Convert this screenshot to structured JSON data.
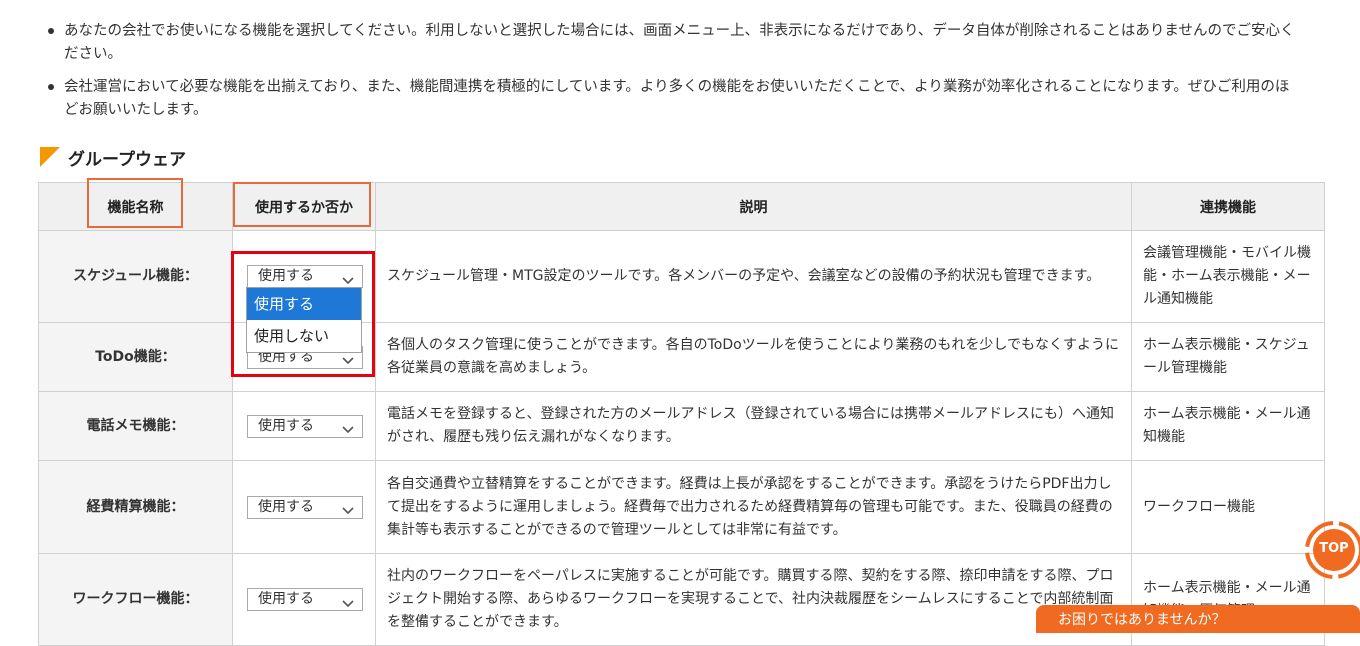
{
  "notes": [
    "あなたの会社でお使いになる機能を選択してください。利用しないと選択した場合には、画面メニュー上、非表示になるだけであり、データ自体が削除されることはありませんのでご安心ください。",
    "会社運営において必要な機能を出揃えており、また、機能間連携を積極的にしています。より多くの機能をお使いいただくことで、より業務が効率化されることになります。ぜひご利用のほどお願いいたします。"
  ],
  "section": {
    "title": "グループウェア",
    "flag_color": "#f39800"
  },
  "table": {
    "headers": {
      "name": "機能名称",
      "use": "使用するか否か",
      "desc": "説明",
      "links": "連携機能"
    },
    "rows": [
      {
        "name": "スケジュール機能：",
        "use": "使用する",
        "desc": "スケジュール管理・MTG設定のツールです。各メンバーの予定や、会議室などの設備の予約状況も管理できます。",
        "links": "会議管理機能・モバイル機能・ホーム表示機能・メール通知機能"
      },
      {
        "name": "ToDo機能：",
        "use": "使用する",
        "desc": "各個人のタスク管理に使うことができます。各自のToDoツールを使うことにより業務のもれを少しでもなくすように各従業員の意識を高めましょう。",
        "links": "ホーム表示機能・スケジュール管理機能"
      },
      {
        "name": "電話メモ機能：",
        "use": "使用する",
        "desc": "電話メモを登録すると、登録された方のメールアドレス（登録されている場合には携帯メールアドレスにも）へ通知がされ、履歴も残り伝え漏れがなくなります。",
        "links": "ホーム表示機能・メール通知機能"
      },
      {
        "name": "経費精算機能：",
        "use": "使用する",
        "desc": "各自交通費や立替精算をすることができます。経費は上長が承認をすることができます。承認をうけたらPDF出力して提出をするように運用しましょう。経費毎で出力されるため経費精算毎の管理も可能です。また、役職員の経費の集計等も表示することができるので管理ツールとしては非常に有益です。",
        "links": "ワークフロー機能"
      },
      {
        "name": "ワークフロー機能：",
        "use": "使用する",
        "desc": "社内のワークフローをペーパレスに実施することが可能です。購買する際、契約をする際、捺印申請をする際、プロジェクト開始する際、あらゆるワークフローを実現することで、社内決裁履歴をシームレスにすることで内部統制面を整備することができます。",
        "links": "ホーム表示機能・メール通知機能・原価管理"
      }
    ]
  },
  "dropdown": {
    "options": [
      "使用する",
      "使用しない"
    ],
    "highlighted": "使用する"
  },
  "floating": {
    "top_label": "TOP",
    "help_label": "お困りではありませんか？"
  },
  "colors": {
    "highlight_box": "#e8693a",
    "dropdown_frame": "#e60012",
    "selected_option": "#1e78d7",
    "accent_orange": "#f06a22"
  }
}
